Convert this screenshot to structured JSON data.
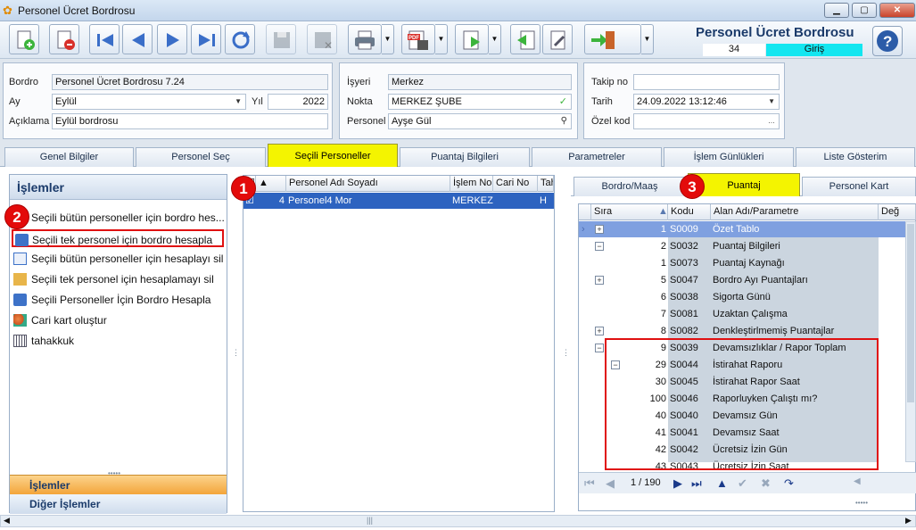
{
  "window": {
    "title": "Personel Ücret Bordrosu"
  },
  "header": {
    "title": "Personel Ücret Bordrosu",
    "number": "34",
    "state": "Giriş"
  },
  "form": {
    "bordro_label": "Bordro",
    "bordro_value": "Personel Ücret Bordrosu 7.24",
    "ay_label": "Ay",
    "ay_value": "Eylül",
    "yil_label": "Yıl",
    "yil_value": "2022",
    "aciklama_label": "Açıklama",
    "aciklama_value": "Eylül bordrosu",
    "isyeri_label": "İşyeri",
    "isyeri_value": "Merkez",
    "nokta_label": "Nokta",
    "nokta_value": "MERKEZ ŞUBE",
    "personel_label": "Personel",
    "personel_value": "Ayşe Gül",
    "takipno_label": "Takip no",
    "takipno_value": "",
    "tarih_label": "Tarih",
    "tarih_value": "24.09.2022 13:12:46",
    "ozelkod_label": "Özel kod",
    "ozelkod_value": ""
  },
  "main_tabs": [
    "Genel Bilgiler",
    "Personel Seç",
    "Seçili Personeller",
    "Puantaj Bilgileri",
    "Parametreler",
    "İşlem Günlükleri",
    "Liste Gösterim"
  ],
  "left_panel": {
    "title": "İşlemler",
    "items": [
      "Seçili bütün personeller için bordro hes...",
      "Seçili tek personel için bordro hesapla",
      "Seçili bütün personeller için hesaplayı sil",
      "Seçili tek personel için hesaplamayı sil",
      "Seçili Personeller İçin Bordro Hesapla",
      "Cari kart oluştur",
      "tahakkuk"
    ],
    "footer1": "İşlemler",
    "footer2": "Diğer İşlemler"
  },
  "mid_grid": {
    "headers": [
      "Personel Adı Soyadı",
      "İşlem No",
      "Cari No",
      "Tah"
    ],
    "row": {
      "num": "4",
      "name": "Personel4 Mor",
      "islem": "MERKEZ :",
      "cari": "",
      "tah": "H"
    }
  },
  "right_tabs": [
    "Bordro/Maaş",
    "Puantaj",
    "Personel Kart"
  ],
  "right_grid": {
    "headers": [
      "Sıra",
      "Kodu",
      "Alan Adı/Parametre",
      "Değ"
    ],
    "rows": [
      {
        "sira": "1",
        "kod": "S0009",
        "ad": "Özet Tablo"
      },
      {
        "sira": "2",
        "kod": "S0032",
        "ad": "Puantaj Bilgileri"
      },
      {
        "sira": "1",
        "kod": "S0073",
        "ad": "Puantaj Kaynağı"
      },
      {
        "sira": "5",
        "kod": "S0047",
        "ad": "Bordro Ayı Puantajları"
      },
      {
        "sira": "6",
        "kod": "S0038",
        "ad": "Sigorta Günü"
      },
      {
        "sira": "7",
        "kod": "S0081",
        "ad": "Uzaktan Çalışma"
      },
      {
        "sira": "8",
        "kod": "S0082",
        "ad": "Denkleştirlmemiş Puantajlar"
      },
      {
        "sira": "9",
        "kod": "S0039",
        "ad": "Devamsızlıklar / Rapor Toplam"
      },
      {
        "sira": "29",
        "kod": "S0044",
        "ad": "İstirahat Raporu"
      },
      {
        "sira": "30",
        "kod": "S0045",
        "ad": "İstirahat Rapor Saat"
      },
      {
        "sira": "100",
        "kod": "S0046",
        "ad": "Raporluyken Çalıştı mı?"
      },
      {
        "sira": "40",
        "kod": "S0040",
        "ad": "Devamsız Gün"
      },
      {
        "sira": "41",
        "kod": "S0041",
        "ad": "Devamsız Saat"
      },
      {
        "sira": "42",
        "kod": "S0042",
        "ad": "Ücretsiz İzin Gün"
      },
      {
        "sira": "43",
        "kod": "S0043",
        "ad": "Ücretsiz İzin Saat"
      }
    ],
    "pager": "1 / 190"
  },
  "badges": [
    "1",
    "2",
    "3"
  ],
  "colors": {
    "accent": "#2d63c0",
    "active_tab": "#f4f400",
    "annotation": "#e01010",
    "state": "#12e6f0"
  }
}
